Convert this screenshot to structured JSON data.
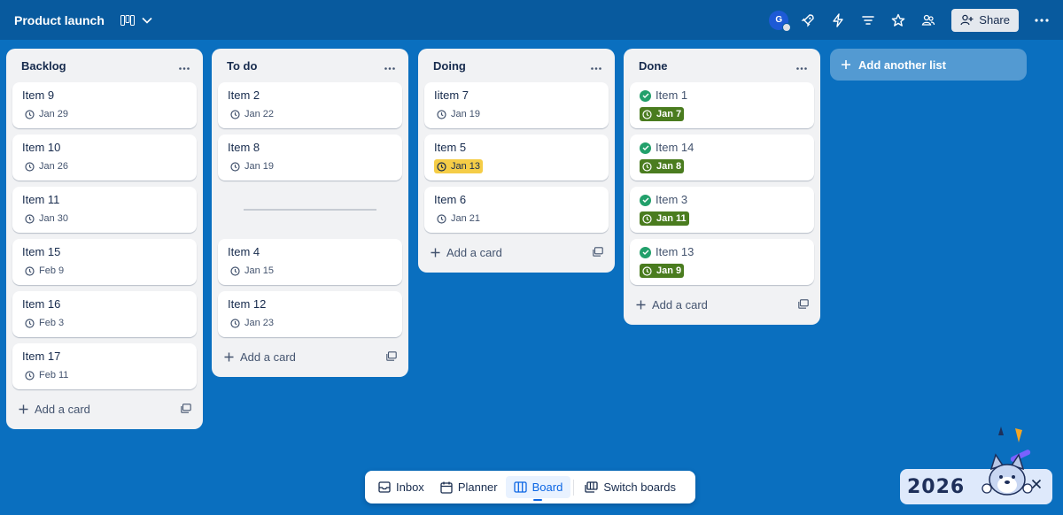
{
  "header": {
    "board_title": "Product launch",
    "avatar_initial": "G",
    "share_label": "Share"
  },
  "lists": [
    {
      "title": "Backlog",
      "add_card_label": "Add a card",
      "cards": [
        {
          "title": "Item 9",
          "due": "Jan 29"
        },
        {
          "title": "Item 10",
          "due": "Jan 26"
        },
        {
          "title": "Item 11",
          "due": "Jan 30"
        },
        {
          "title": "Item 15",
          "due": "Feb 9"
        },
        {
          "title": "Item 16",
          "due": "Feb 3"
        },
        {
          "title": "Item 17",
          "due": "Feb 11"
        }
      ]
    },
    {
      "title": "To do",
      "add_card_label": "Add a card",
      "cards": [
        {
          "title": "Item 2",
          "due": "Jan 22"
        },
        {
          "title": "Item 8",
          "due": "Jan 19"
        },
        {
          "title": "Item 4",
          "due": "Jan 15"
        },
        {
          "title": "Item 12",
          "due": "Jan 23"
        }
      ]
    },
    {
      "title": "Doing",
      "add_card_label": "Add a card",
      "cards": [
        {
          "title": "Iitem 7",
          "due": "Jan 19"
        },
        {
          "title": "Item 5",
          "due": "Jan 13",
          "status": "due-soon"
        },
        {
          "title": "Item 6",
          "due": "Jan 21"
        }
      ]
    },
    {
      "title": "Done",
      "add_card_label": "Add a card",
      "cards": [
        {
          "title": "Item 1",
          "due": "Jan 7",
          "status": "complete"
        },
        {
          "title": "Item 14",
          "due": "Jan 8",
          "status": "complete"
        },
        {
          "title": "Item 3",
          "due": "Jan 11",
          "status": "complete"
        },
        {
          "title": "Item 13",
          "due": "Jan 9",
          "status": "complete"
        }
      ]
    }
  ],
  "add_list_label": "Add another list",
  "bottom_nav": {
    "inbox": "Inbox",
    "planner": "Planner",
    "board": "Board",
    "switch_boards": "Switch boards"
  },
  "promo": {
    "year": "2026"
  },
  "colors": {
    "board_bg": "#0a6fbf",
    "header_bg": "#085a9e",
    "due_soon": "#f5cd47",
    "complete": "#4a7c1f",
    "check": "#22a06b"
  }
}
